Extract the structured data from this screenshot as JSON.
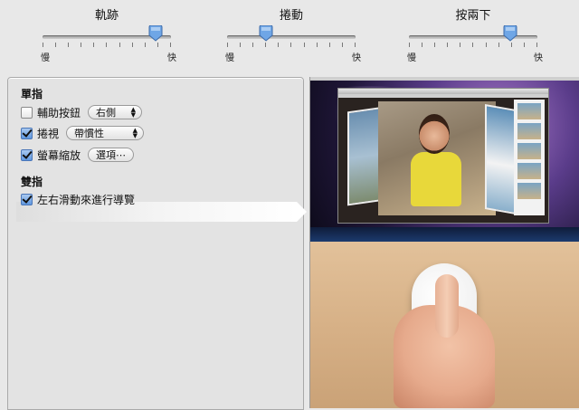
{
  "sliders": [
    {
      "title": "軌跡",
      "min_label": "慢",
      "max_label": "快",
      "value": 0.88
    },
    {
      "title": "捲動",
      "min_label": "慢",
      "max_label": "快",
      "value": 0.3
    },
    {
      "title": "按兩下",
      "min_label": "慢",
      "max_label": "快",
      "value": 0.79
    }
  ],
  "single_finger": {
    "heading": "單指",
    "secondary_click": {
      "label": "輔助按鈕",
      "checked": false,
      "popup_value": "右側"
    },
    "scroll": {
      "label": "捲視",
      "checked": true,
      "popup_value": "帶慣性"
    },
    "screen_zoom": {
      "label": "螢幕縮放",
      "checked": true,
      "button_label": "選項⋯"
    }
  },
  "two_fingers": {
    "heading": "雙指",
    "swipe_navigate": {
      "label": "左右滑動來進行導覽",
      "checked": true
    }
  },
  "colors": {
    "accent": "#5f98e0",
    "panel": "#e3e3e3",
    "background": "#e8e8e8"
  },
  "icons": {
    "checkbox_checked": "checkmark-icon",
    "popup_arrows": "up-down-arrows-icon"
  }
}
